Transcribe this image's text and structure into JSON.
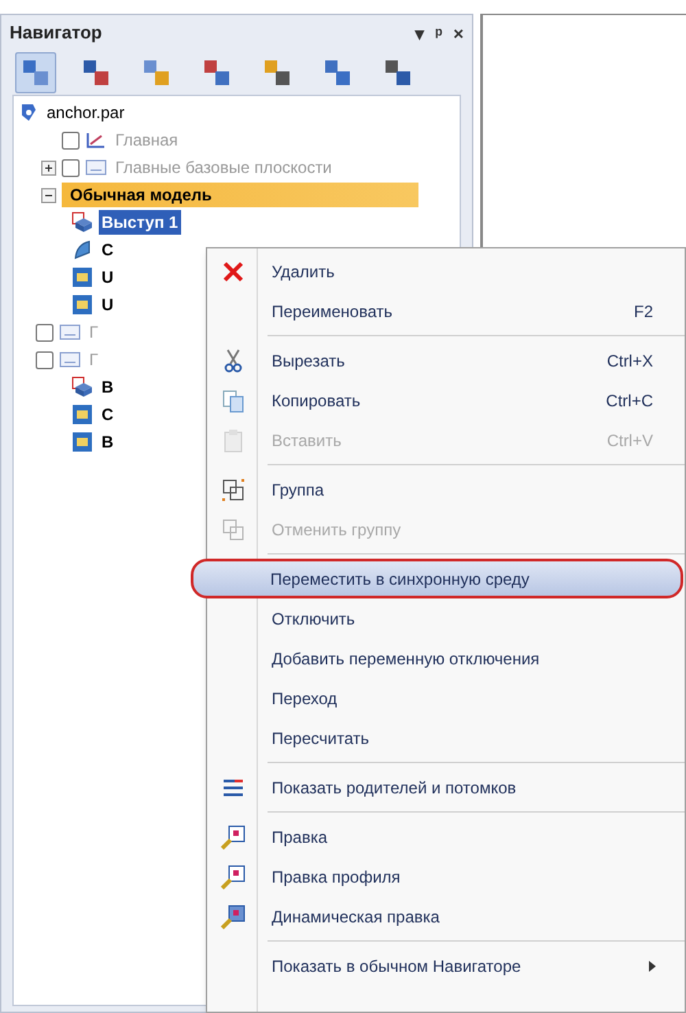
{
  "panel": {
    "title": "Навигатор",
    "controls": [
      "▾",
      "ᵖ",
      "×"
    ]
  },
  "toolbar": [
    {
      "selected": true
    },
    {
      "selected": false
    },
    {
      "selected": false
    },
    {
      "selected": false
    },
    {
      "selected": false
    },
    {
      "selected": false
    },
    {
      "selected": false
    }
  ],
  "tree": [
    {
      "label": "anchor.par",
      "kind": "file",
      "children": [
        {
          "label": "Главная",
          "kind": "sketch",
          "disabled": true,
          "checked": false
        },
        {
          "label": "Главные базовые плоскости",
          "kind": "plane",
          "disabled": true,
          "checked": false,
          "expanded": false
        },
        {
          "label": "Обычная модель",
          "kind": "group",
          "expanded": true,
          "children": [
            {
              "label": "Выступ 1",
              "kind": "extrude",
              "selected": true
            },
            {
              "label": "С",
              "kind": "surface",
              "selected": false
            },
            {
              "label": "U",
              "kind": "feature",
              "selected": false
            },
            {
              "label": "U",
              "kind": "feature",
              "selected": false
            },
            {
              "label": "Г",
              "kind": "plane",
              "selected": false,
              "disabled": true,
              "checked": false
            },
            {
              "label": "Г",
              "kind": "plane",
              "selected": false,
              "disabled": true,
              "checked": false
            },
            {
              "label": "В",
              "kind": "extrude",
              "selected": false
            },
            {
              "label": "С",
              "kind": "feature",
              "selected": false
            },
            {
              "label": "В",
              "kind": "feature",
              "selected": false
            }
          ]
        }
      ]
    }
  ],
  "context_menu": [
    {
      "kind": "item",
      "label": "Удалить",
      "disabled": false,
      "selected": false
    },
    {
      "kind": "item",
      "label": "Переименовать",
      "shortcut": "F2",
      "disabled": false,
      "selected": false
    },
    {
      "kind": "separator"
    },
    {
      "kind": "item",
      "label": "Вырезать",
      "shortcut": "Ctrl+X",
      "disabled": false,
      "selected": false
    },
    {
      "kind": "item",
      "label": "Копировать",
      "shortcut": "Ctrl+C",
      "disabled": false,
      "selected": false
    },
    {
      "kind": "item",
      "label": "Вставить",
      "shortcut": "Ctrl+V",
      "disabled": true,
      "selected": false
    },
    {
      "kind": "separator"
    },
    {
      "kind": "item",
      "label": "Группа",
      "disabled": false,
      "selected": false
    },
    {
      "kind": "item",
      "label": "Отменить группу",
      "disabled": true,
      "selected": false
    },
    {
      "kind": "separator"
    },
    {
      "kind": "item",
      "label": "Переместить в синхронную среду",
      "disabled": false,
      "selected": true,
      "circled": true
    },
    {
      "kind": "item",
      "label": "Отключить",
      "disabled": false,
      "selected": false
    },
    {
      "kind": "item",
      "label": "Добавить переменную отключения",
      "disabled": false,
      "selected": false
    },
    {
      "kind": "item",
      "label": "Переход",
      "disabled": false,
      "selected": false
    },
    {
      "kind": "item",
      "label": "Пересчитать",
      "disabled": false,
      "selected": false
    },
    {
      "kind": "separator"
    },
    {
      "kind": "item",
      "label": "Показать родителей и потомков",
      "disabled": false,
      "selected": false
    },
    {
      "kind": "separator"
    },
    {
      "kind": "item",
      "label": "Правка",
      "disabled": false,
      "selected": false
    },
    {
      "kind": "item",
      "label": "Правка профиля",
      "disabled": false,
      "selected": false
    },
    {
      "kind": "item",
      "label": "Динамическая правка",
      "disabled": false,
      "selected": false
    },
    {
      "kind": "separator"
    },
    {
      "kind": "item",
      "label": "Показать в обычном Навигаторе",
      "disabled": false,
      "selected": false,
      "submenu": true
    }
  ]
}
